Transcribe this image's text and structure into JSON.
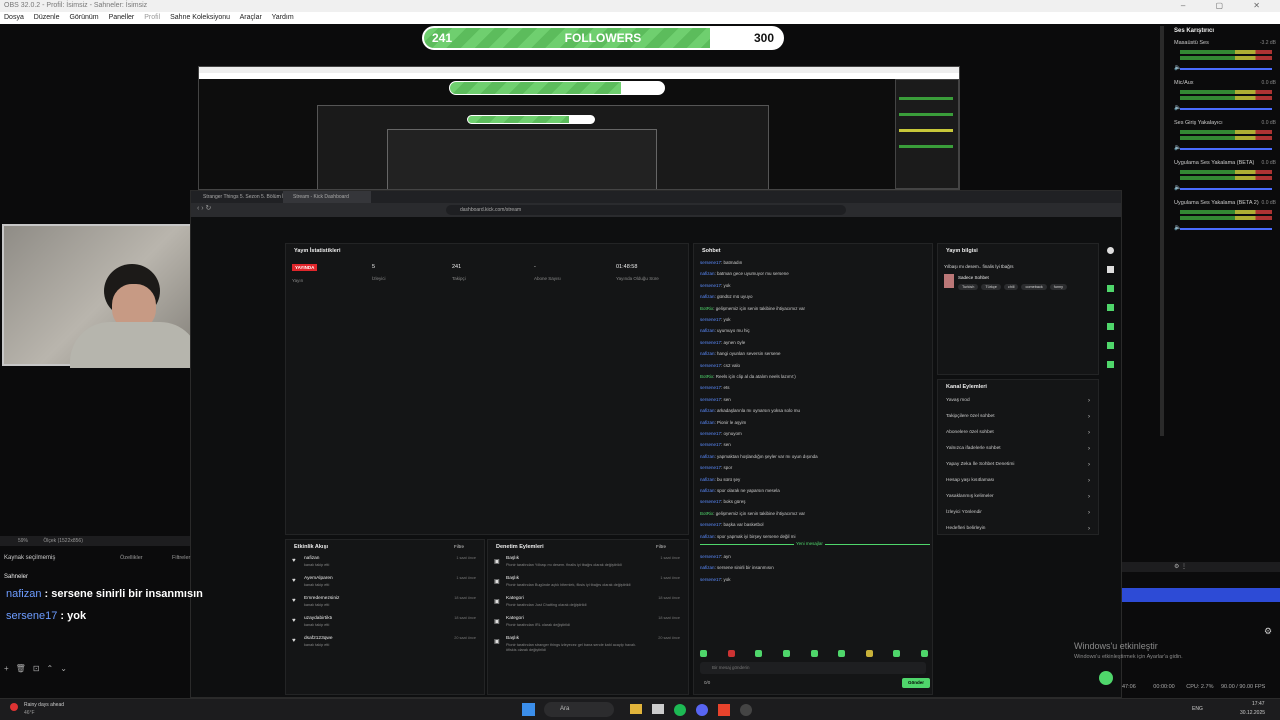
{
  "window": {
    "title": "OBS 32.0.2 - Profil: İsimsiz - Sahneler: İsimsiz"
  },
  "menu": [
    "Dosya",
    "Düzenle",
    "Görünüm",
    "Paneller",
    "Profil",
    "Sahne Koleksiyonu",
    "Araçlar",
    "Yardım"
  ],
  "follower_goal": {
    "current": "241",
    "label": "FOLLOWERS",
    "goal": "300",
    "progress": 0.8
  },
  "browser": {
    "tabs": [
      "Stranger Things 5. Sezon 5. Bölüm İz",
      "Stream - Kick Dashboard"
    ],
    "url": "dashboard.kick.com/stream"
  },
  "stats": {
    "title": "Yayın İstatistikleri",
    "live_badge": "YAYINDA",
    "values": [
      {
        "value": "5",
        "label": "İzleyici"
      },
      {
        "value": "241",
        "label": "Takipçi"
      },
      {
        "value": "-",
        "label": "Abone Sayısı"
      },
      {
        "value": "01:48:58",
        "label": "Yayında Olduğu Süre"
      }
    ],
    "status_label": "Yayın"
  },
  "chat": {
    "title": "Sohbet",
    "lines": [
      {
        "user": "sersene17",
        "text": ": batmadın"
      },
      {
        "user": "nafizan",
        "text": ": batman gece uyumuyor mu sersene"
      },
      {
        "user": "sersene17",
        "text": ": yok"
      },
      {
        "user": "nafizan",
        "text": ": gündüz mü uyuyo"
      },
      {
        "user": "BotRix",
        "text": ": gelişmemiz için senin takibine ihtiyacımız var",
        "bot": true
      },
      {
        "user": "sersene17",
        "text": ": yok"
      },
      {
        "user": "nafizan",
        "text": ": uyumuyo mu hiç"
      },
      {
        "user": "sersene17",
        "text": ": aynen öyle"
      },
      {
        "user": "nafizan",
        "text": ": hangi oyunları seversin sersene"
      },
      {
        "user": "sersene17",
        "text": ": cs2 valo"
      },
      {
        "user": "BotRix",
        "text": ": Reels için clip al da atalım neels lazım!:)",
        "bot": true
      },
      {
        "user": "sersene17",
        "text": ": ets"
      },
      {
        "user": "sersene17",
        "text": ": sen"
      },
      {
        "user": "nafizan",
        "text": ": arkadaşlarınla mı oynarsın yoksa solo mu"
      },
      {
        "user": "nafizan",
        "text": ": Pionir le aşyim"
      },
      {
        "user": "sersene17",
        "text": ": oynuyom"
      },
      {
        "user": "sersene17",
        "text": ": sen"
      },
      {
        "user": "nafizan",
        "text": ": yapmaktan hoşlandığın şeyler var mı oyun dışında"
      },
      {
        "user": "sersene17",
        "text": ": spor"
      },
      {
        "user": "nafizan",
        "text": ": bu sürü şey"
      },
      {
        "user": "nafizan",
        "text": ": spor olarak ne yaparsın mesela"
      },
      {
        "user": "sersene17",
        "text": ": boks güreş"
      },
      {
        "user": "BotRix",
        "text": ": gelişmemiz için senin takibine ihtiyacımız var",
        "bot": true
      },
      {
        "user": "sersene17",
        "text": ": başka var basketbol"
      },
      {
        "user": "nafizan",
        "text": ": spor yapmak iyi birşey sersene değil mi"
      }
    ],
    "new_messages": "Yeni mesajlar",
    "after_lines": [
      {
        "user": "sersene17",
        "text": ": ayn"
      },
      {
        "user": "nafizan",
        "text": ": sersene sinirli bir insanmısın"
      },
      {
        "user": "sersene17",
        "text": ": yok"
      }
    ],
    "input_placeholder": "Bir mesaj gönderin",
    "send": "Gönder",
    "count": "0/0"
  },
  "stream_info": {
    "title": "Yayın bilgisi",
    "stream_title": "Yılbaşı mı desem.. finalis İyi tbağrs",
    "category": "Sadece Sohbet",
    "tags": [
      "Turkish",
      "Türkçe",
      "chill",
      "comeback",
      "funny"
    ]
  },
  "channel_actions": {
    "title": "Kanal Eylemleri",
    "items": [
      "Yavaş mod",
      "Takipçilere özel sohbet",
      "Abonelere özel sohbet",
      "Yalnızca ifadelerle sohbet",
      "Yapay Zeka İle Sohbet Denetimi",
      "Hesap yaşı kısıtlaması",
      "Yasaklanmış kelimeler",
      "İzleyici Yönlendir",
      "Hedefleri belirleyin"
    ]
  },
  "activity": {
    "title": "Etkinlik Akışı",
    "filter": "Filtre",
    "items": [
      {
        "name": "nafizan",
        "sub": "kanalı takip etti",
        "time": "1 saat önce"
      },
      {
        "name": "AyemAlparen",
        "sub": "kanalı takip etti",
        "time": "1 saat önce"
      },
      {
        "name": "Emredemezsiniz",
        "sub": "kanalı takip etti",
        "time": "18 saat önce"
      },
      {
        "name": "uzaydabirtiktı",
        "sub": "kanalı takip etti",
        "time": "18 saat önce"
      },
      {
        "name": "dsaf2123qwe",
        "sub": "kanalı takip etti",
        "time": "20 saat önce"
      }
    ]
  },
  "moderation": {
    "title": "Denetim Eylemleri",
    "filter": "Filtre",
    "items": [
      {
        "name": "Başlık",
        "sub": "Pionir tarafından Yılbaşı mı desem. finalis iyi tbağrs olarak değiştirildi",
        "time": "1 saat önce"
      },
      {
        "name": "Başlık",
        "sub": "Pionir tarafından Bugünde açtık bitemlek, fiksis iyi tbağrs olarak değiştirildi",
        "time": "1 saat önce"
      },
      {
        "name": "Kategori",
        "sub": "Pionir tarafından Just Chatting olarak değiştirildi",
        "time": "18 saat önce"
      },
      {
        "name": "Kategori",
        "sub": "Pionir tarafından IRL olarak değiştirildi",
        "time": "18 saat önce"
      },
      {
        "name": "Başlık",
        "sub": "Pionir tarafından stranger things izleyecez gel bana sende katıl acaylp havalı. #fiskis olarak değiştirildi",
        "time": "20 saat önce"
      }
    ]
  },
  "obs_left": {
    "zoom": "59%",
    "resolution": "Ölçek (1522x856)",
    "source_none": "Kaynak seçilmemiş",
    "properties": "Özellikler",
    "filters": "Filtreler",
    "scenes": "Sahneler"
  },
  "overlay_chat": [
    {
      "user": "nafizan",
      "text": " : sersene sinirli bir insanmısın"
    },
    {
      "user": "sersene17",
      "text": " : yok"
    }
  ],
  "mixer": {
    "title": "Ses Karıştırıcı",
    "items": [
      {
        "name": "Masaüstü Ses",
        "db": "-3.2 dB"
      },
      {
        "name": "Mic/Aux",
        "db": "0.0 dB"
      },
      {
        "name": "Ses Giriş Yakalayıcı",
        "db": "0.0 dB"
      },
      {
        "name": "Uygulama Ses Yakalama (BETA)",
        "db": "0.0 dB"
      },
      {
        "name": "Uygulama Ses Yakalama (BETA 2)",
        "db": "0.0 dB"
      }
    ]
  },
  "watermark": {
    "title": "Windows'u etkinleştir",
    "sub": "Windows'u etkinleştirmek için Ayarlar'a gidin."
  },
  "status": {
    "time": "47:06",
    "rec": "00:00:00",
    "cpu": "CPU: 2.7%",
    "fps": "90.00 / 90.00 FPS"
  },
  "taskbar": {
    "weather": "Rainy days ahead",
    "temp": "46°F",
    "search": "Ara",
    "lang": "ENG",
    "clock": "17:47",
    "date": "30.12.2025"
  }
}
